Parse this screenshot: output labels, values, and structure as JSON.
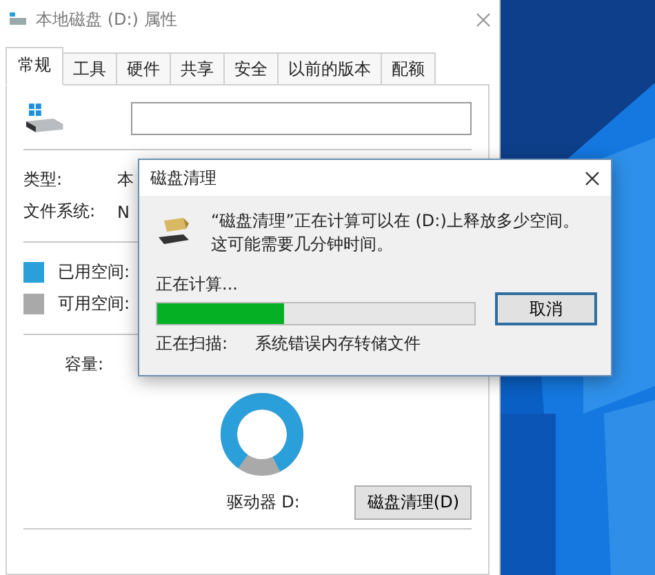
{
  "properties_window": {
    "title": "本地磁盘 (D:) 属性",
    "tabs": [
      {
        "label": "常规",
        "selected": true
      },
      {
        "label": "工具",
        "selected": false
      },
      {
        "label": "硬件",
        "selected": false
      },
      {
        "label": "共享",
        "selected": false
      },
      {
        "label": "安全",
        "selected": false
      },
      {
        "label": "以前的版本",
        "selected": false
      },
      {
        "label": "配额",
        "selected": false
      }
    ],
    "fields": [
      {
        "label": "类型:",
        "value": "本"
      },
      {
        "label": "文件系统:",
        "value": "N"
      }
    ],
    "space_legend": [
      {
        "label": "已用空间:",
        "color": "#2b9fd9"
      },
      {
        "label": "可用空间:",
        "color": "#a9a9a9"
      }
    ],
    "capacity_label": "容量:",
    "drive_label": "驱动器 D:",
    "cleanup_button": "磁盘清理(D)"
  },
  "cleanup_dialog": {
    "title": "磁盘清理",
    "message": "“磁盘清理”正在计算可以在 (D:)上释放多少空间。这可能需要几分钟时间。",
    "status": "正在计算...",
    "progress": {
      "level": 0.4
    },
    "cancel_button": "取消",
    "scan_label": "正在扫描:",
    "scan_item": "系统错误内存转储文件"
  }
}
